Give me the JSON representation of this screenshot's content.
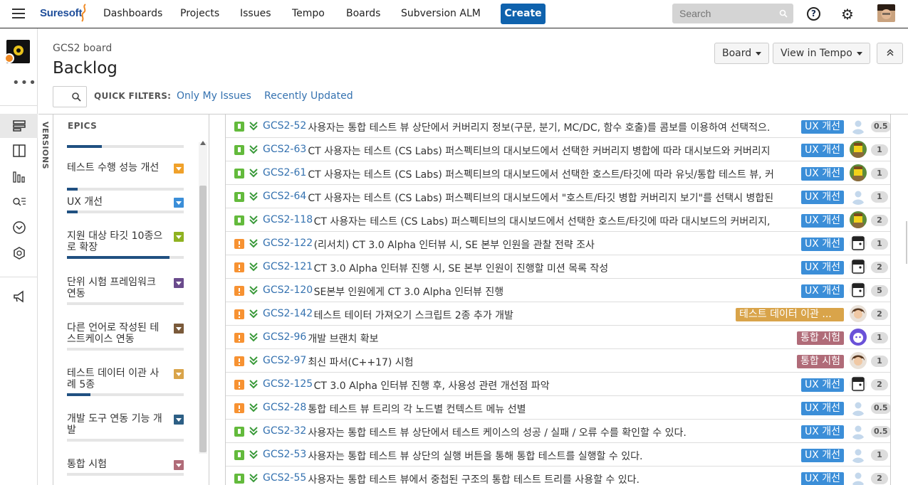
{
  "nav": {
    "logo": "Suresoft",
    "items": [
      "Dashboards",
      "Projects",
      "Issues",
      "Tempo",
      "Boards",
      "Subversion ALM"
    ],
    "create": "Create",
    "search_placeholder": "Search"
  },
  "header": {
    "board_name": "GCS2 board",
    "title": "Backlog",
    "board_btn": "Board",
    "tempo_btn": "View in Tempo",
    "quick_filters_label": "QUICK FILTERS:",
    "filters": [
      "Only My Issues",
      "Recently Updated"
    ]
  },
  "versions_label": "VERSIONS",
  "epics": {
    "title": "EPICS",
    "items": [
      {
        "name": "테스트 수행 성능 개선",
        "color": "#f0a12a",
        "progress": 0.09
      },
      {
        "name": "UX 개선",
        "color": "#3b8ed8",
        "progress": 0.09
      },
      {
        "name": "지원 대상 타깃 10종으로 확장",
        "color": "#8fb221",
        "progress": 0.88
      },
      {
        "name": "단위 시험 프레임워크 연동",
        "color": "#6a4b8c",
        "progress": 0.0
      },
      {
        "name": "다른 언어로 작성된 테스트케이스 연동",
        "color": "#7a5a3a",
        "progress": 0.0
      },
      {
        "name": "테스트 데이터 이관 사례 5종",
        "color": "#d9a44a",
        "progress": 0.2
      },
      {
        "name": "개발 도구 연동 기능 개발",
        "color": "#2d5f85",
        "progress": 0.0
      },
      {
        "name": "통합 시험",
        "color": "#b06b78",
        "progress": 0.0
      }
    ]
  },
  "issues": [
    {
      "type": "story",
      "key": "GCS2-52",
      "summary": "사용자는 통합 테스트 뷰 상단에서 커버리지 정보(구문, 분기, MC/DC, 함수 호출)를 콤보를 이용하여 선택적으.",
      "label": "UX 개선",
      "label_color": "#3b8ed8",
      "assignee": "blank",
      "estimate": "0.5"
    },
    {
      "type": "story",
      "key": "GCS2-63",
      "summary": "CT 사용자는 테스트 (CS Labs) 퍼스펙티브의 대시보드에서 선택한 커버리지 병합에 따라 대시보드와 커버리지",
      "label": "UX 개선",
      "label_color": "#3b8ed8",
      "assignee": "lego",
      "estimate": "1"
    },
    {
      "type": "story",
      "key": "GCS2-61",
      "summary": "CT 사용자는 테스트 (CS Labs) 퍼스펙티브의 대시보드에서 선택한 호스트/타깃에 따라 유닛/통합 테스트 뷰, 커",
      "label": "UX 개선",
      "label_color": "#3b8ed8",
      "assignee": "lego",
      "estimate": "1"
    },
    {
      "type": "story",
      "key": "GCS2-64",
      "summary": "CT 사용자는 테스트 (CS Labs) 퍼스펙티브의 대시보드에서 \"호스트/타깃 병합 커버리지 보기\"를 선택시 병합된",
      "label": "UX 개선",
      "label_color": "#3b8ed8",
      "assignee": "blank",
      "estimate": "1"
    },
    {
      "type": "story",
      "key": "GCS2-118",
      "summary": "CT 사용자는 테스트 (CS Labs) 퍼스펙티브의 대시보드에서 선택한 호스트/타깃에 따라 대시보드의 커버리지,",
      "label": "UX 개선",
      "label_color": "#3b8ed8",
      "assignee": "lego",
      "estimate": "2"
    },
    {
      "type": "task",
      "key": "GCS2-122",
      "summary": "(리서치) CT 3.0 Alpha 인터뷰 시, SE 본부 인원을 관찰 전략 조사",
      "label": "UX 개선",
      "label_color": "#3b8ed8",
      "assignee": "cartoon",
      "estimate": "1"
    },
    {
      "type": "task",
      "key": "GCS2-121",
      "summary": "CT 3.0 Alpha 인터뷰 진행 시, SE 본부 인원이 진행할 미션 목록 작성",
      "label": "UX 개선",
      "label_color": "#3b8ed8",
      "assignee": "cartoon",
      "estimate": "2"
    },
    {
      "type": "task",
      "key": "GCS2-120",
      "summary": "SE본부 인원에게 CT 3.0 Alpha 인터뷰 진행",
      "label": "UX 개선",
      "label_color": "#3b8ed8",
      "assignee": "cartoon",
      "estimate": "5"
    },
    {
      "type": "task",
      "key": "GCS2-142",
      "summary": "테스트 테이터 가져오기 스크립트 2종 추가 개발",
      "label": "테스트 데이터 이관 ...",
      "label_color": "#d9a44a",
      "assignee": "person",
      "estimate": "2"
    },
    {
      "type": "task",
      "key": "GCS2-96",
      "summary": "개발 브랜치 확보",
      "label": "통합 시험",
      "label_color": "#b06b78",
      "assignee": "robot",
      "estimate": "1"
    },
    {
      "type": "task",
      "key": "GCS2-97",
      "summary": "최신 파서(C++17) 시험",
      "label": "통합 시험",
      "label_color": "#b06b78",
      "assignee": "person",
      "estimate": "1"
    },
    {
      "type": "task",
      "key": "GCS2-125",
      "summary": "CT 3.0 Alpha 인터뷰 진행 후, 사용성 관련 개선점 파악",
      "label": "UX 개선",
      "label_color": "#3b8ed8",
      "assignee": "cartoon",
      "estimate": "2"
    },
    {
      "type": "task",
      "key": "GCS2-28",
      "summary": "통합 테스트 뷰 트리의 각 노드별 컨텍스트 메뉴 선별",
      "label": "UX 개선",
      "label_color": "#3b8ed8",
      "assignee": "blank",
      "estimate": "0.5"
    },
    {
      "type": "story",
      "key": "GCS2-32",
      "summary": "사용자는 통합 테스트 뷰 상단에서 테스트 케이스의 성공 / 실패 / 오류 수를 확인할 수 있다.",
      "label": "UX 개선",
      "label_color": "#3b8ed8",
      "assignee": "blank",
      "estimate": "0.5"
    },
    {
      "type": "story",
      "key": "GCS2-53",
      "summary": "사용자는 통합 테스트 뷰 상단의 실행 버튼을 통해 통합 테스트를 실행할 수 있다.",
      "label": "UX 개선",
      "label_color": "#3b8ed8",
      "assignee": "blank",
      "estimate": "1"
    },
    {
      "type": "story",
      "key": "GCS2-55",
      "summary": "사용자는 통합 테스트 뷰에서 중첩된 구조의 통합 테스트 트리를 사용할 수 있다.",
      "label": "UX 개선",
      "label_color": "#3b8ed8",
      "assignee": "blank",
      "estimate": "2"
    }
  ]
}
